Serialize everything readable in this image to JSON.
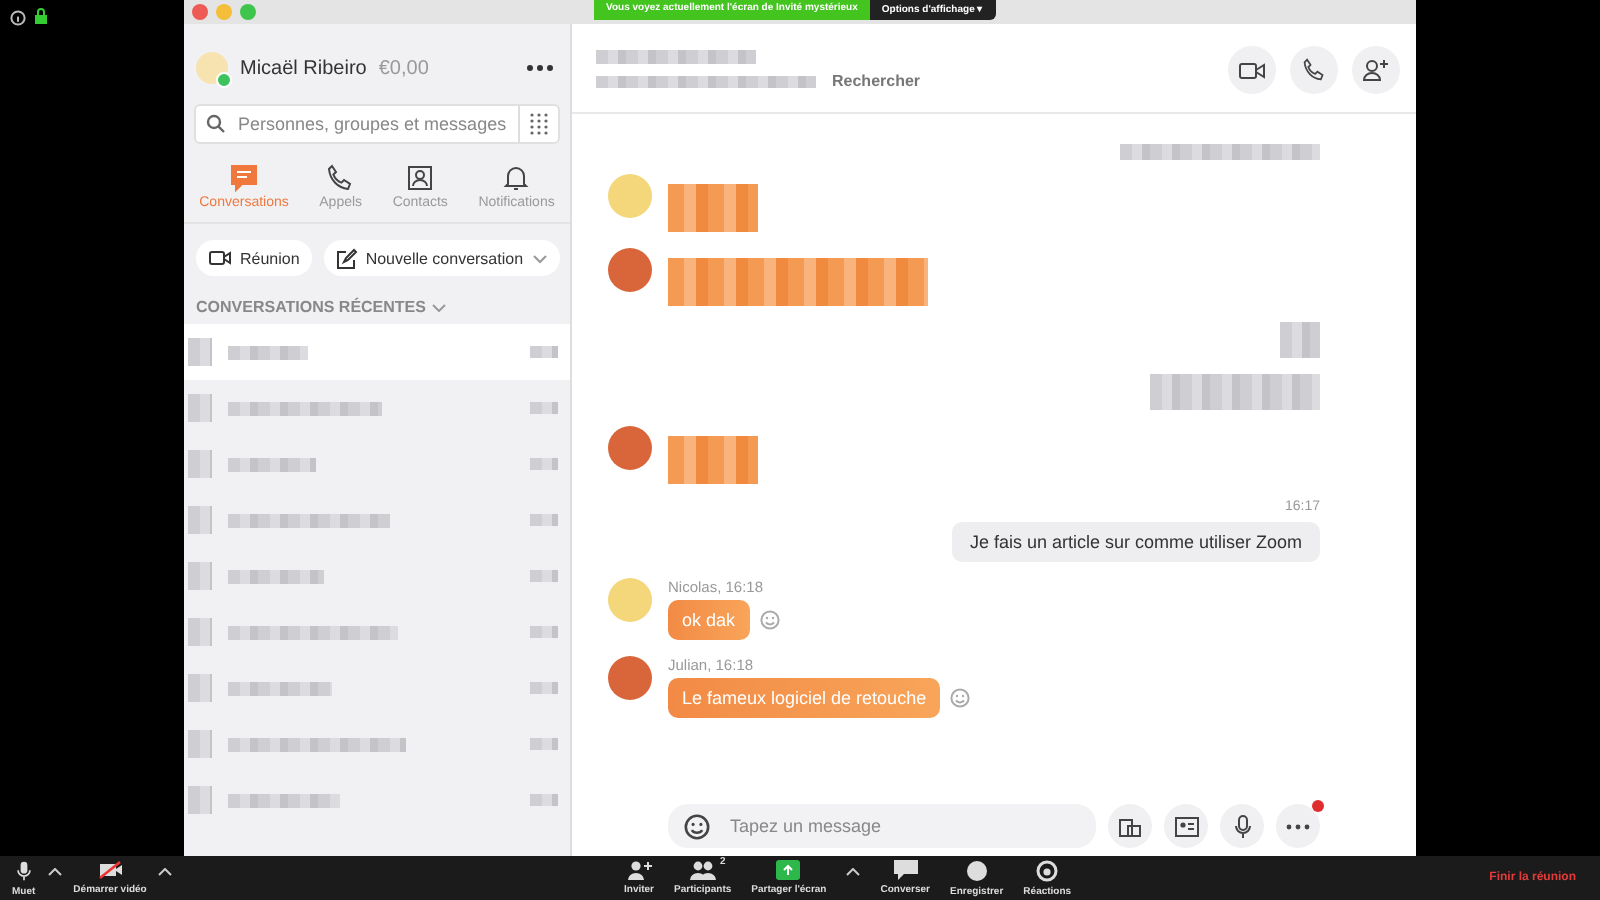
{
  "share_banner": {
    "message": "Vous voyez actuellement l'écran de Invité mystérieux",
    "options": "Options d'affichage",
    "caret": "▾"
  },
  "profile": {
    "name": "Micaël Ribeiro",
    "balance": "€0,00",
    "online": true
  },
  "search": {
    "placeholder": "Personnes, groupes et messages"
  },
  "nav_tabs": [
    {
      "kind": "chat",
      "label": "Conversations",
      "selected": true
    },
    {
      "kind": "phone",
      "label": "Appels",
      "selected": false
    },
    {
      "kind": "contact",
      "label": "Contacts",
      "selected": false
    },
    {
      "kind": "bell",
      "label": "Notifications",
      "selected": false
    }
  ],
  "actions": [
    {
      "kind": "meeting",
      "label": "Réunion"
    },
    {
      "kind": "compose",
      "label": "Nouvelle conversation"
    }
  ],
  "recent_header": "CONVERSATIONS RÉCENTES",
  "conversations": [
    {
      "selected": true
    },
    {
      "selected": false
    },
    {
      "selected": false
    },
    {
      "selected": false
    },
    {
      "selected": false
    },
    {
      "selected": false
    },
    {
      "selected": false
    },
    {
      "selected": false
    },
    {
      "selected": false
    }
  ],
  "chat_header": {
    "search_label": "Rechercher"
  },
  "messages": [
    {
      "kind": "blurred_in",
      "color": "#f3d77a"
    },
    {
      "kind": "blurred_in",
      "color": "#d9663a"
    },
    {
      "kind": "blurred_out"
    },
    {
      "kind": "blurred_out"
    },
    {
      "kind": "blurred_in",
      "color": "#d9663a"
    },
    {
      "kind": "time",
      "text": "16:17"
    },
    {
      "kind": "out",
      "text": "Je fais un article sur comme utiliser Zoom"
    },
    {
      "kind": "in",
      "color": "#f3d77a",
      "meta": "Nicolas, 16:18",
      "text": "ok dak"
    },
    {
      "kind": "in",
      "color": "#d9663a",
      "meta": "Julian, 16:18",
      "text": "Le fameux logiciel de retouche"
    }
  ],
  "composer": {
    "placeholder": "Tapez un message",
    "more_notification": true
  },
  "toolbar_left": [
    {
      "kind": "mic",
      "label": "Muet"
    },
    {
      "kind": "video-off",
      "label": "Démarrer vidéo"
    }
  ],
  "toolbar_center": [
    {
      "kind": "invite",
      "label": "Inviter"
    },
    {
      "kind": "participants",
      "label": "Participants",
      "count": "2"
    },
    {
      "kind": "share",
      "label": "Partager l'écran"
    },
    {
      "kind": "chat",
      "label": "Converser"
    },
    {
      "kind": "record",
      "label": "Enregistrer"
    },
    {
      "kind": "react",
      "label": "Réactions"
    }
  ],
  "end_meeting": "Finir la réunion"
}
